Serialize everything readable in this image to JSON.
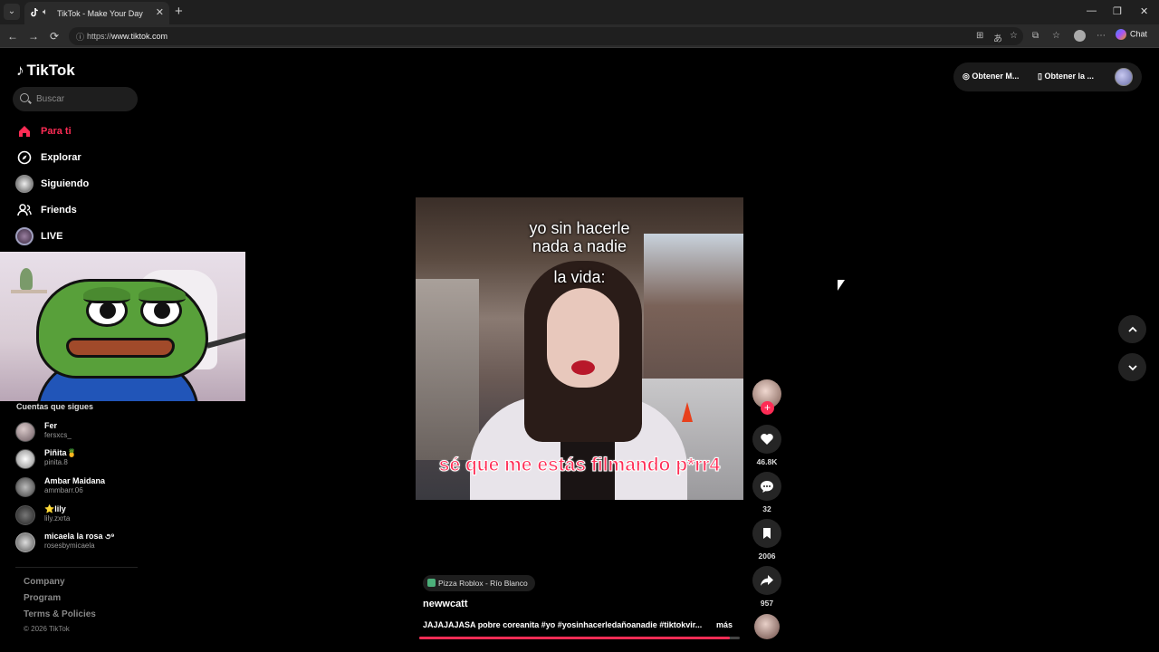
{
  "browser": {
    "tab_title": "TikTok - Make Your Day",
    "url_prefix": "https://",
    "url_host": "www.tiktok.com",
    "chat_label": "Chat",
    "new_tab": "+",
    "tab_close": "✕",
    "minimize": "—",
    "restore": "❐",
    "close": "✕",
    "back": "←",
    "forward": "→",
    "reload": "⟳"
  },
  "brand": {
    "name": "TikTok",
    "logo_glyph": "♪"
  },
  "search": {
    "placeholder": "Buscar"
  },
  "nav": [
    {
      "label": "Para ti",
      "icon": "home-icon",
      "glyph": "⌂",
      "active": true
    },
    {
      "label": "Explorar",
      "icon": "compass-icon",
      "glyph": "◎",
      "active": false
    },
    {
      "label": "Siguiendo",
      "icon": "following-avatar-icon",
      "glyph": "",
      "active": false
    },
    {
      "label": "Friends",
      "icon": "friends-icon",
      "glyph": "⚇",
      "active": false
    },
    {
      "label": "LIVE",
      "icon": "live-avatar-icon",
      "glyph": "",
      "active": false
    }
  ],
  "following": {
    "title": "Cuentas que sigues",
    "accounts": [
      {
        "name": "Fer",
        "handle": "fersxcs_"
      },
      {
        "name": "Piñita🍍",
        "handle": "pinita.8"
      },
      {
        "name": "Ambar Maidana",
        "handle": "ammbarr.06"
      },
      {
        "name": "⭐lily",
        "handle": "lily.zxrta"
      },
      {
        "name": "micaela la rosa ૭⁹",
        "handle": "rosesbymicaela"
      }
    ]
  },
  "footer": {
    "links": [
      "Company",
      "Program",
      "Terms & Policies"
    ],
    "copyright": "© 2026 TikTok"
  },
  "top_actions": {
    "btn1": "Obtener M...",
    "btn2": "Obtener la ..."
  },
  "video": {
    "caption_top": "yo sin hacerle\nnada a nadie",
    "caption_mid": "la vida:",
    "caption_bottom": "sé que me estás filmando p*rr4",
    "progress": 0.97
  },
  "actions": {
    "follow_plus": "+",
    "likes": "46.8K",
    "comments": "32",
    "saves": "2006",
    "shares": "957"
  },
  "meta": {
    "music": "Pizza Roblox - Río Blanco",
    "author": "newwcatt",
    "description": "JAJAJAJASA pobre coreanita #yo #yosinhacerledañoanadie #tiktokvir...",
    "more": "más"
  },
  "scroll": {
    "up": "⌃",
    "down": "⌄"
  }
}
